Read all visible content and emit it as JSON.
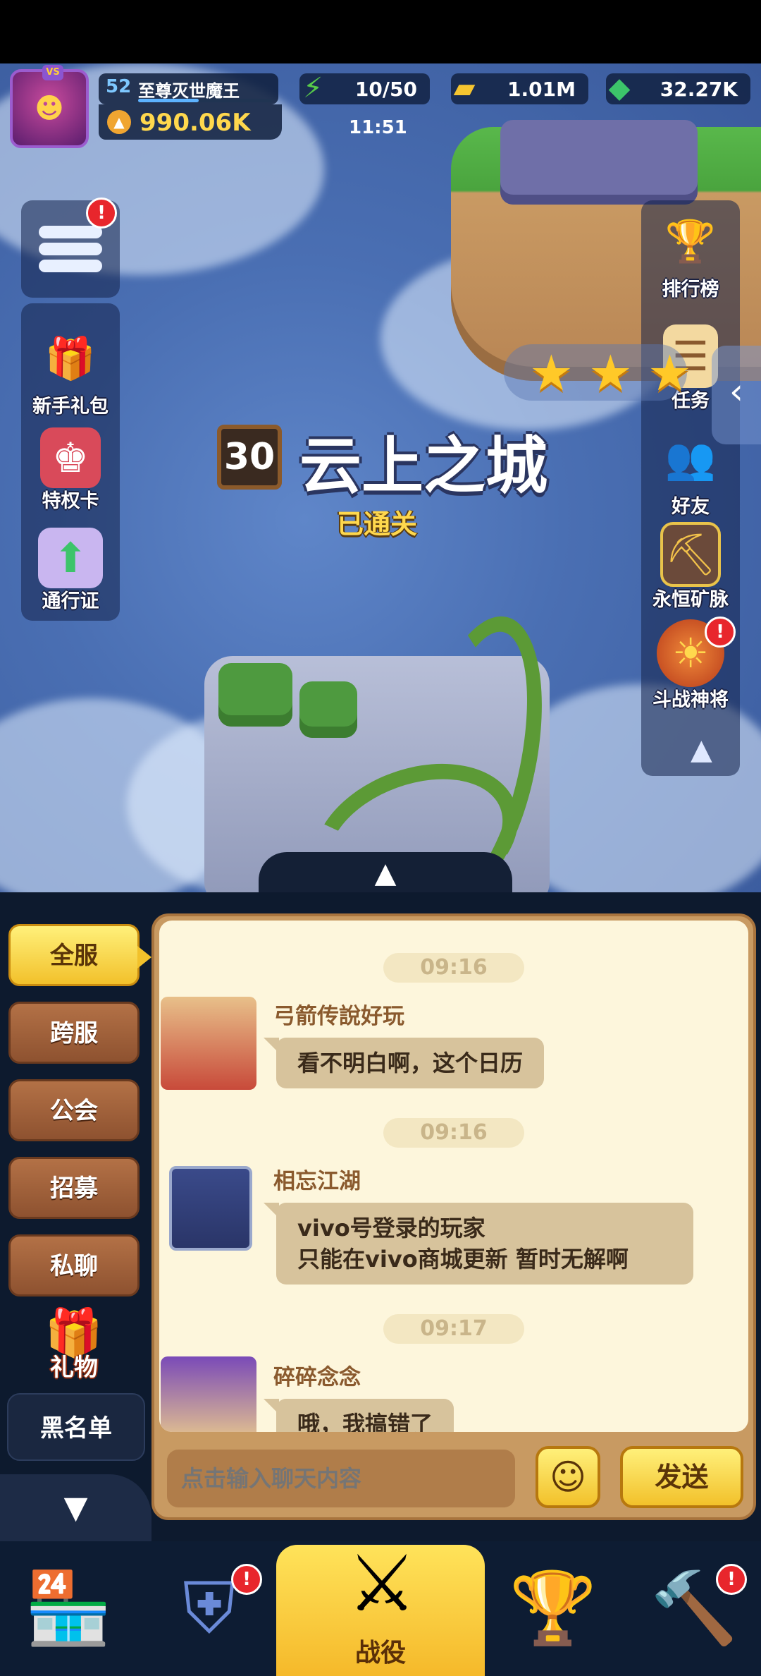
{
  "player": {
    "level": "52",
    "name": "至尊灭世魔王",
    "avatar_badge": "VS",
    "power": "990.06K",
    "xp_fraction": 0.45
  },
  "resources": {
    "stamina": "10/50",
    "gold": "1.01M",
    "gems": "32.27K"
  },
  "clock": "11:51",
  "left_menu": {
    "menu_badge": "!",
    "items": [
      {
        "label": "新手礼包",
        "icon": "gift-box-icon"
      },
      {
        "label": "特权卡",
        "icon": "privilege-card-icon"
      },
      {
        "label": "通行证",
        "icon": "pass-chest-icon"
      }
    ]
  },
  "right_menu": {
    "items": [
      {
        "label": "排行榜",
        "icon": "leaderboard-trophy-icon"
      },
      {
        "label": "任务",
        "icon": "task-scroll-icon"
      },
      {
        "label": "好友",
        "icon": "friends-icon"
      },
      {
        "label": "永恒矿脉",
        "icon": "mine-gate-icon"
      },
      {
        "label": "斗战神将",
        "icon": "monkey-king-icon",
        "badge": "!"
      }
    ]
  },
  "stage": {
    "number": "30",
    "name": "云上之城",
    "status": "已通关",
    "stars": 3
  },
  "chat": {
    "tabs": [
      "全服",
      "跨服",
      "公会",
      "招募",
      "私聊"
    ],
    "active_tab": "全服",
    "gift_label": "礼物",
    "blacklist_label": "黑名单",
    "messages": [
      {
        "time": "09:16",
        "name": "弓箭传說好玩",
        "text": "看不明白啊，这个日历",
        "avatar": "new-year-avatar"
      },
      {
        "time": "09:16",
        "name": "相忘江湖",
        "text_line1": "vivo号登录的玩家",
        "text_line2": "只能在vivo商城更新 暂时无解啊",
        "avatar": "crossed-swords-avatar"
      },
      {
        "time": "09:17",
        "name": "碎碎念念",
        "text": "哦，我搞错了",
        "avatar": "white-hair-avatar"
      }
    ],
    "input_placeholder": "点击输入聊天内容",
    "send_label": "发送"
  },
  "bottom_nav": {
    "items": [
      {
        "name": "shop",
        "icon": "shop-icon"
      },
      {
        "name": "equipment",
        "icon": "armor-icon",
        "badge": "!"
      },
      {
        "name": "campaign",
        "icon": "crossed-swords-icon",
        "label": "战役",
        "active": true
      },
      {
        "name": "trophy",
        "icon": "trophy-icon"
      },
      {
        "name": "talents",
        "icon": "hammer-board-icon",
        "badge": "!"
      }
    ]
  },
  "colors": {
    "accent_yellow": "#f2c12b",
    "chat_bg": "#fdf6dc",
    "nav_bg": "#0d1c33",
    "alert_red": "#e8262c"
  }
}
